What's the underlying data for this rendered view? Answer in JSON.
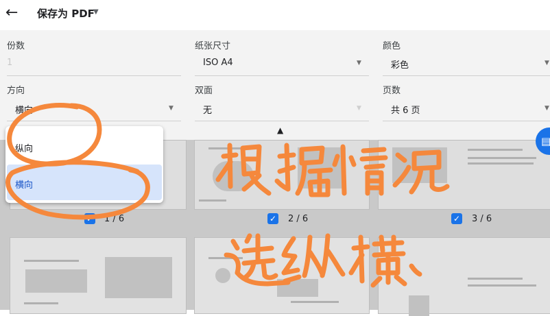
{
  "header": {
    "back_icon": "arrow-left-icon",
    "title": "保存为 PDF"
  },
  "settings": {
    "copies": {
      "label": "份数",
      "value": "1"
    },
    "paper_size": {
      "label": "纸张尺寸",
      "value": "ISO A4"
    },
    "color": {
      "label": "颜色",
      "value": "彩色"
    },
    "orientation": {
      "label": "方向",
      "value": "横向",
      "options": [
        "纵向",
        "横向"
      ],
      "selected": "横向"
    },
    "duplex": {
      "label": "双面",
      "value": "无"
    },
    "pages": {
      "label": "页数",
      "value": "共 6 页"
    }
  },
  "preview": {
    "pages": [
      {
        "number": "1 / 6"
      },
      {
        "number": "2 / 6"
      },
      {
        "number": "3 / 6"
      }
    ]
  },
  "annotation": {
    "text": "根据情况 选纵横、",
    "color": "#f5883c"
  },
  "colors": {
    "accent": "#1a73e8",
    "selection": "#d6e4fb"
  }
}
